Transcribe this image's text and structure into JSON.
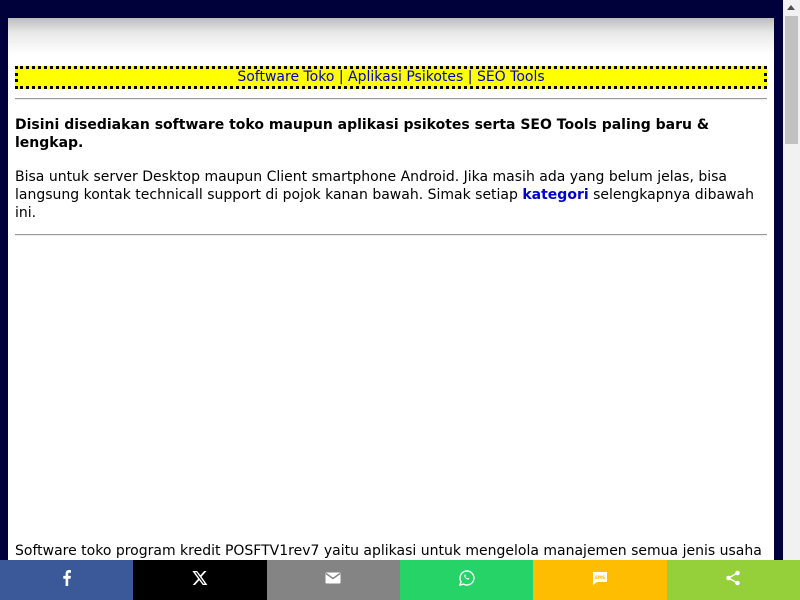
{
  "nav": {
    "link1": "Software Toko",
    "sep1": " | ",
    "link2": "Aplikasi Psikotes",
    "sep2": " | ",
    "link3": "SEO Tools"
  },
  "intro": {
    "bold": "Disini disediakan software toko maupun aplikasi psikotes serta SEO Tools paling baru & lengkap.",
    "text_before": "Bisa untuk server Desktop maupun Client smartphone Android. Jika masih ada yang belum jelas, bisa langsung kontak technicall support di pojok kanan bawah. Simak setiap ",
    "link": "kategori",
    "text_after": " selengkapnya dibawah ini."
  },
  "article": {
    "first_line": "Software toko program kredit POSFTV1rev7 yaitu aplikasi untuk mengelola manajemen semua jenis usaha &"
  },
  "share": {
    "buttons": [
      {
        "name": "facebook",
        "color": "#3b5998",
        "icon": "facebook-icon"
      },
      {
        "name": "x",
        "color": "#000000",
        "icon": "x-icon"
      },
      {
        "name": "email",
        "color": "#848484",
        "icon": "email-icon"
      },
      {
        "name": "whatsapp",
        "color": "#25d366",
        "icon": "whatsapp-icon"
      },
      {
        "name": "sms",
        "color": "#ffbd00",
        "icon": "sms-icon"
      },
      {
        "name": "share",
        "color": "#95d03a",
        "icon": "share-icon"
      }
    ]
  },
  "colors": {
    "frame": "#00003a",
    "nav_bg": "#ffff00",
    "link": "#0000cc"
  }
}
